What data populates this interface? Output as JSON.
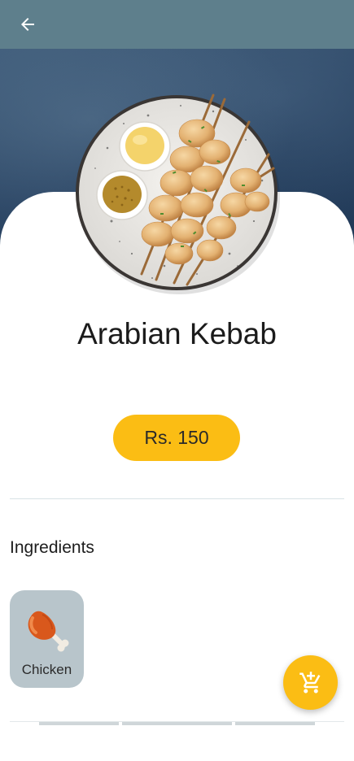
{
  "appbar": {
    "back_icon": "arrow-left-icon",
    "color": "#5e7f8c"
  },
  "product": {
    "name": "Arabian Kebab",
    "price": "Rs. 150",
    "image": "kebab-plate-illustration"
  },
  "ingredients": {
    "heading": "Ingredients",
    "items": [
      {
        "label": "Chicken",
        "icon": "chicken-leg-icon"
      }
    ]
  },
  "fab": {
    "icon": "add-to-cart-icon"
  },
  "colors": {
    "accent": "#fbbd14",
    "chip_bg": "#b8c5cb",
    "hero_bg": "#2a4463"
  }
}
